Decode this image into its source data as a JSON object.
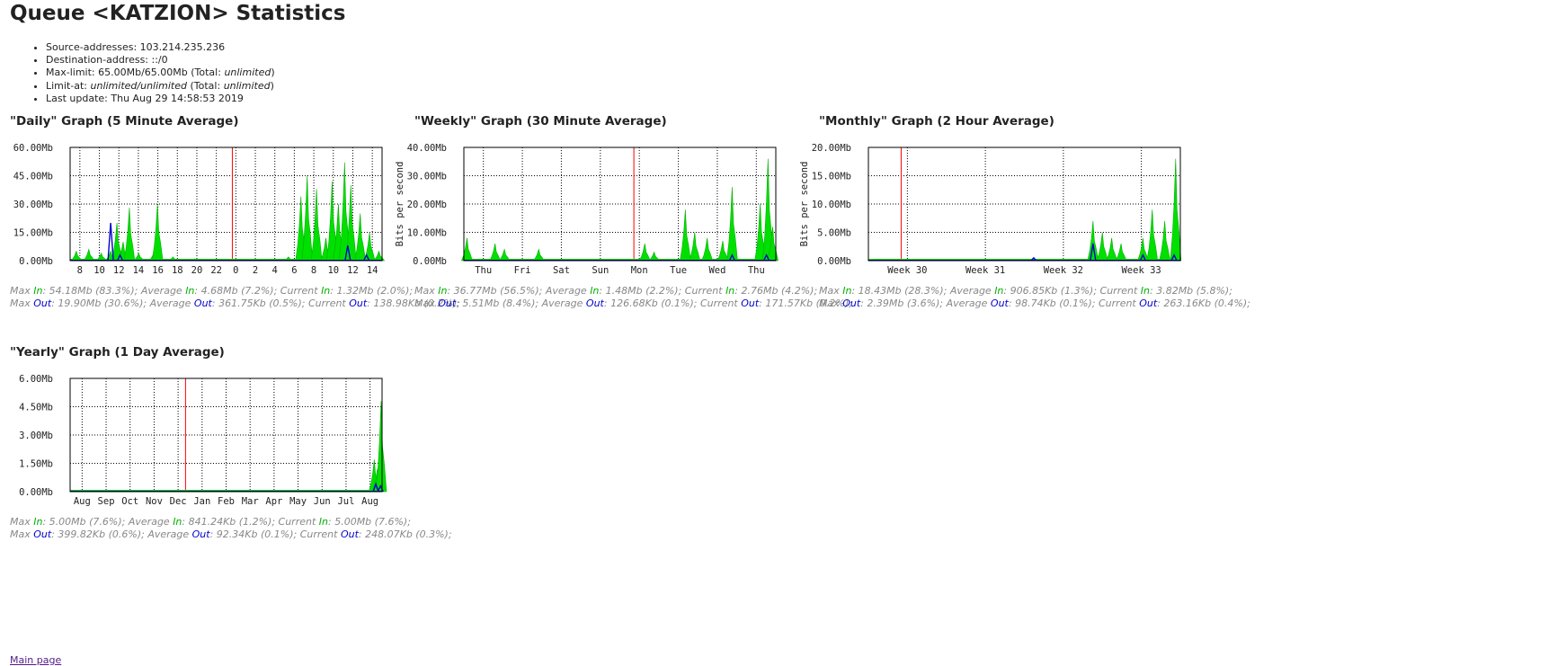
{
  "page": {
    "title": "Queue <KATZION> Statistics",
    "info": [
      {
        "label": "Source-addresses:",
        "value": " 103.214.235.236"
      },
      {
        "label": "Destination-address:",
        "value": " ::/0"
      },
      {
        "label": "Max-limit:",
        "value": " 65.00Mb/65.00Mb (Total: ",
        "italic": "unlimited",
        "tail": ")"
      },
      {
        "label": "Limit-at:",
        "value": " ",
        "italic": "unlimited/unlimited",
        "mid": " (Total: ",
        "italic2": "unlimited",
        "tail": ")"
      },
      {
        "label": "Last update:",
        "value": " Thu Aug 29 14:58:53 2019"
      }
    ],
    "main_link": "Main page"
  },
  "colors": {
    "in": "#00e000",
    "in_line": "#00b000",
    "out": "#0000cc",
    "grid": "#000000",
    "now": "#ff0000"
  },
  "chart_data": [
    {
      "id": "daily",
      "type": "area",
      "title": "\"Daily\" Graph (5 Minute Average)",
      "ylabel": "",
      "yticks": [
        "0.00Mb",
        "15.00Mb",
        "30.00Mb",
        "45.00Mb",
        "60.00Mb"
      ],
      "ylim": [
        0,
        60
      ],
      "xticks": [
        "8",
        "10",
        "12",
        "14",
        "16",
        "18",
        "20",
        "22",
        "0",
        "2",
        "4",
        "6",
        "8",
        "10",
        "12",
        "14"
      ],
      "now_position": 0.52,
      "in_peaks": [
        [
          0.02,
          5
        ],
        [
          0.06,
          6
        ],
        [
          0.1,
          4
        ],
        [
          0.13,
          5
        ],
        [
          0.15,
          20
        ],
        [
          0.17,
          10
        ],
        [
          0.19,
          28
        ],
        [
          0.22,
          4
        ],
        [
          0.27,
          5
        ],
        [
          0.28,
          30
        ],
        [
          0.33,
          2
        ],
        [
          0.4,
          1
        ],
        [
          0.7,
          2
        ],
        [
          0.74,
          34
        ],
        [
          0.76,
          45
        ],
        [
          0.79,
          38
        ],
        [
          0.82,
          12
        ],
        [
          0.84,
          42
        ],
        [
          0.86,
          30
        ],
        [
          0.88,
          52
        ],
        [
          0.9,
          40
        ],
        [
          0.93,
          25
        ],
        [
          0.96,
          15
        ],
        [
          0.99,
          5
        ]
      ],
      "out_peaks": [
        [
          0.13,
          20
        ],
        [
          0.16,
          3
        ],
        [
          0.89,
          8
        ],
        [
          0.95,
          3
        ]
      ],
      "stats": {
        "max_in": "54.18Mb (83.3%)",
        "avg_in": "4.68Mb (7.2%)",
        "cur_in": "1.32Mb (2.0%)",
        "max_out": "19.90Mb (30.6%)",
        "avg_out": "361.75Kb (0.5%)",
        "cur_out": "138.98Kb (0.2%)"
      }
    },
    {
      "id": "weekly",
      "type": "area",
      "title": "\"Weekly\" Graph (30 Minute Average)",
      "ylabel": "Bits per second",
      "yticks": [
        "0.00Mb",
        "10.00Mb",
        "20.00Mb",
        "30.00Mb",
        "40.00Mb"
      ],
      "ylim": [
        0,
        40
      ],
      "xticks": [
        "Thu",
        "Fri",
        "Sat",
        "Sun",
        "Mon",
        "Tue",
        "Wed",
        "Thu"
      ],
      "now_position": 0.545,
      "in_peaks": [
        [
          0.01,
          8
        ],
        [
          0.1,
          6
        ],
        [
          0.13,
          4
        ],
        [
          0.24,
          4
        ],
        [
          0.58,
          6
        ],
        [
          0.61,
          3
        ],
        [
          0.71,
          18
        ],
        [
          0.74,
          10
        ],
        [
          0.78,
          8
        ],
        [
          0.83,
          7
        ],
        [
          0.86,
          26
        ],
        [
          0.95,
          20
        ],
        [
          0.975,
          36
        ],
        [
          0.99,
          12
        ]
      ],
      "out_peaks": [
        [
          0.86,
          2
        ],
        [
          0.97,
          2
        ]
      ],
      "stats": {
        "max_in": "36.77Mb (56.5%)",
        "avg_in": "1.48Mb (2.2%)",
        "cur_in": "2.76Mb (4.2%)",
        "max_out": "5.51Mb (8.4%)",
        "avg_out": "126.68Kb (0.1%)",
        "cur_out": "171.57Kb (0.2%)"
      }
    },
    {
      "id": "monthly",
      "type": "area",
      "title": "\"Monthly\" Graph (2 Hour Average)",
      "ylabel": "Bits per second",
      "yticks": [
        "0.00Mb",
        "5.00Mb",
        "10.00Mb",
        "15.00Mb",
        "20.00Mb"
      ],
      "ylim": [
        0,
        20
      ],
      "xticks": [
        "Week 30",
        "Week 31",
        "Week 32",
        "Week 33"
      ],
      "now_position": 0.105,
      "in_peaks": [
        [
          0.72,
          7
        ],
        [
          0.75,
          5
        ],
        [
          0.78,
          4
        ],
        [
          0.81,
          3
        ],
        [
          0.88,
          4
        ],
        [
          0.91,
          9
        ],
        [
          0.95,
          7
        ],
        [
          0.985,
          18
        ]
      ],
      "out_peaks": [
        [
          0.53,
          0.5
        ],
        [
          0.72,
          3
        ],
        [
          0.88,
          1
        ],
        [
          0.98,
          1
        ]
      ],
      "stats": {
        "max_in": "18.43Mb (28.3%)",
        "avg_in": "906.85Kb (1.3%)",
        "cur_in": "3.82Mb (5.8%)",
        "max_out": "2.39Mb (3.6%)",
        "avg_out": "98.74Kb (0.1%)",
        "cur_out": "263.16Kb (0.4%)"
      }
    },
    {
      "id": "yearly",
      "type": "area",
      "title": "\"Yearly\" Graph (1 Day Average)",
      "ylabel": "",
      "yticks": [
        "0.00Mb",
        "1.50Mb",
        "3.00Mb",
        "4.50Mb",
        "6.00Mb"
      ],
      "ylim": [
        0,
        6
      ],
      "xticks": [
        "Aug",
        "Sep",
        "Oct",
        "Nov",
        "Dec",
        "Jan",
        "Feb",
        "Mar",
        "Apr",
        "May",
        "Jun",
        "Jul",
        "Aug"
      ],
      "now_position": 0.37,
      "in_peaks": [
        [
          0.975,
          1.7
        ],
        [
          0.985,
          1.2
        ],
        [
          0.997,
          4.8
        ]
      ],
      "out_peaks": [
        [
          0.98,
          0.4
        ],
        [
          0.995,
          0.3
        ]
      ],
      "stats": {
        "max_in": "5.00Mb (7.6%)",
        "avg_in": "841.24Kb (1.2%)",
        "cur_in": "5.00Mb (7.6%)",
        "max_out": "399.82Kb (0.6%)",
        "avg_out": "92.34Kb (0.1%)",
        "cur_out": "248.07Kb (0.3%)"
      }
    }
  ]
}
